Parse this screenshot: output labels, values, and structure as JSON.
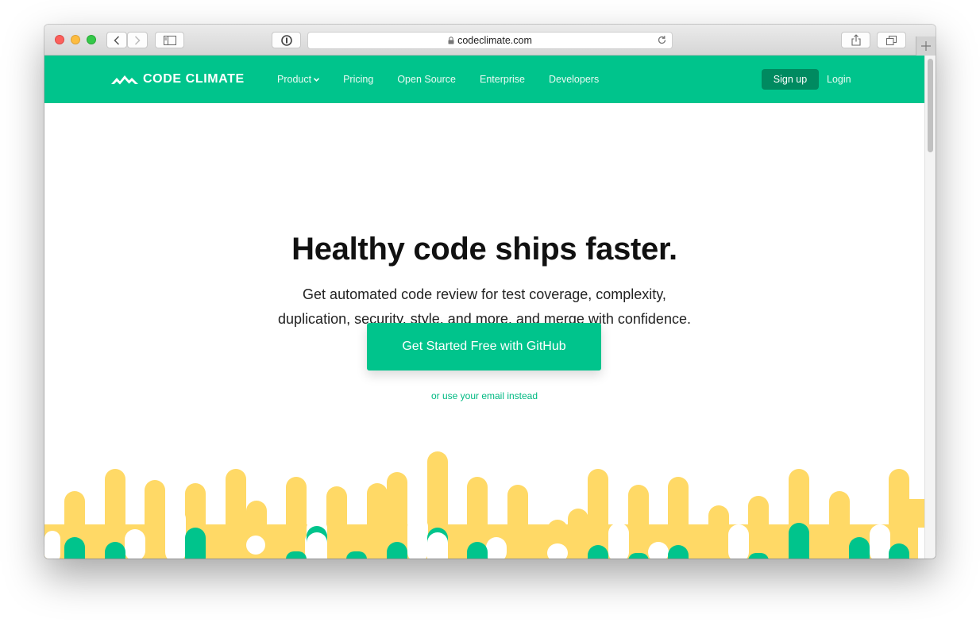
{
  "browser": {
    "url": "codeclimate.com",
    "icons": [
      "close-light",
      "minimize-light",
      "maximize-light",
      "back-arrow-icon",
      "forward-arrow-icon",
      "sidebar-icon",
      "password-icon",
      "lock-icon",
      "reload-icon",
      "share-icon",
      "tabs-icon",
      "new-tab-plus-icon"
    ]
  },
  "nav": {
    "logo": "CODE CLIMATE",
    "links": [
      {
        "label": "Product",
        "dropdown": true
      },
      {
        "label": "Pricing"
      },
      {
        "label": "Open Source"
      },
      {
        "label": "Enterprise"
      },
      {
        "label": "Developers"
      }
    ],
    "signup": "Sign up",
    "login": "Login"
  },
  "hero": {
    "headline": "Healthy code ships faster.",
    "sub_line1": "Get automated code review for test coverage, complexity,",
    "sub_line2": "duplication, security, style, and more, and merge with confidence.",
    "cta": "Get Started Free with GitHub",
    "alt_link": "or use your email instead"
  },
  "colors": {
    "brand_green": "#00c48c",
    "dark_green": "#008a60",
    "drip_yellow": "#ffd966"
  }
}
